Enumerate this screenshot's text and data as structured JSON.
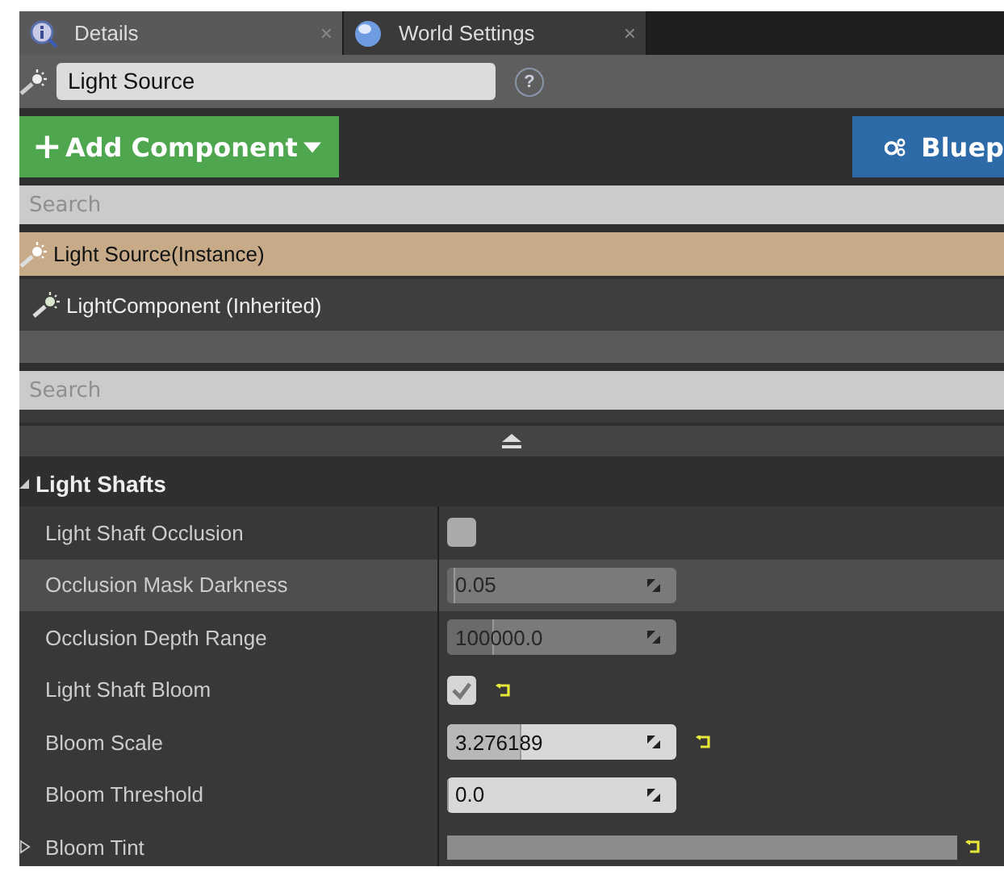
{
  "tabs": [
    {
      "label": "Details",
      "close": "×",
      "selected": true
    },
    {
      "label": "World Settings",
      "close": "×",
      "selected": false
    }
  ],
  "actor_name": {
    "value": "Light Source",
    "help": "?"
  },
  "add_component_button": {
    "plus": "+",
    "label": "Add Component"
  },
  "blueprint_button": {
    "label": "Bluep"
  },
  "component_search": {
    "placeholder": "Search"
  },
  "components": [
    {
      "label": "Light Source(Instance)",
      "selected": true
    },
    {
      "label": "LightComponent (Inherited)",
      "selected": false
    }
  ],
  "property_search": {
    "placeholder": "Search"
  },
  "category": {
    "label": "Light Shafts",
    "expanded": true
  },
  "properties": [
    {
      "label": "Light Shaft Occlusion",
      "kind": "checkbox",
      "checked": false,
      "modified": false,
      "highlighted": false
    },
    {
      "label": "Occlusion Mask Darkness",
      "kind": "number",
      "value": "0.05",
      "level": 0.03,
      "disabled": true,
      "modified": false,
      "highlighted": true
    },
    {
      "label": "Occlusion Depth Range",
      "kind": "number",
      "value": "100000.0",
      "level": 0.2,
      "disabled": true,
      "modified": false,
      "highlighted": false
    },
    {
      "label": "Light Shaft Bloom",
      "kind": "checkbox",
      "checked": true,
      "modified": true,
      "highlighted": false
    },
    {
      "label": "Bloom Scale",
      "kind": "number",
      "value": "3.276189",
      "level": 0.32,
      "disabled": false,
      "modified": true,
      "highlighted": false
    },
    {
      "label": "Bloom Threshold",
      "kind": "number",
      "value": "0.0",
      "level": 0,
      "disabled": false,
      "modified": false,
      "highlighted": false
    },
    {
      "label": "Bloom Tint",
      "kind": "color",
      "color": "#8c8c8c",
      "expanded": false,
      "modified": true,
      "highlighted": false
    }
  ]
}
